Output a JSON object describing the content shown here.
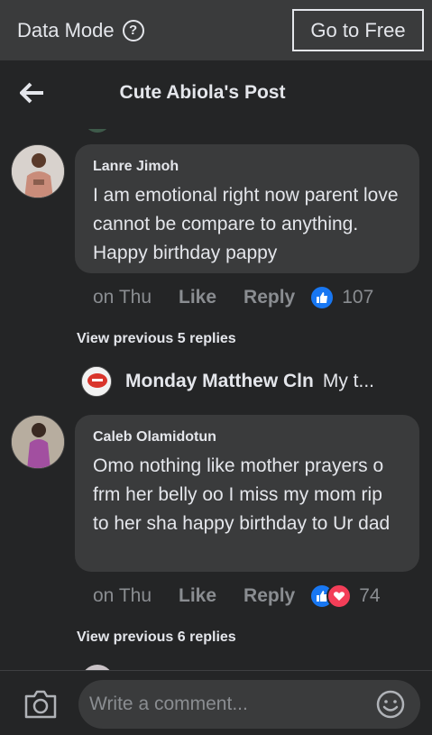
{
  "topbar": {
    "data_mode_label": "Data Mode",
    "help_glyph": "?",
    "go_free_label": "Go to Free"
  },
  "header": {
    "title": "Cute Abiola's Post",
    "back_icon": "arrow-left-icon"
  },
  "comments": [
    {
      "author": "Lanre Jimoh",
      "text": "I am emotional right now parent love cannot be compare to anything. Happy birthday pappy",
      "time": "on Thu",
      "like_label": "Like",
      "reply_label": "Reply",
      "reactions": [
        "like"
      ],
      "reaction_count": "107",
      "view_replies": "View previous 5 replies",
      "reply_preview": {
        "name": "Monday Matthew Cln",
        "snippet": "My t..."
      }
    },
    {
      "author": "Caleb Olamidotun",
      "text": "Omo nothing like mother prayers o frm her belly oo I miss my mom rip to her sha happy birthday to Ur dad",
      "time": "on Thu",
      "like_label": "Like",
      "reply_label": "Reply",
      "reactions": [
        "like",
        "love"
      ],
      "reaction_count": "74",
      "view_replies": "View previous 6 replies"
    }
  ],
  "composer": {
    "placeholder": "Write a comment...",
    "camera_icon": "camera-icon",
    "emoji_icon": "emoji-icon"
  },
  "colors": {
    "background": "#242526",
    "bubble": "#3a3b3c",
    "like_blue": "#1877f2",
    "love_red": "#f33e58",
    "muted_text": "#8a8d91"
  }
}
